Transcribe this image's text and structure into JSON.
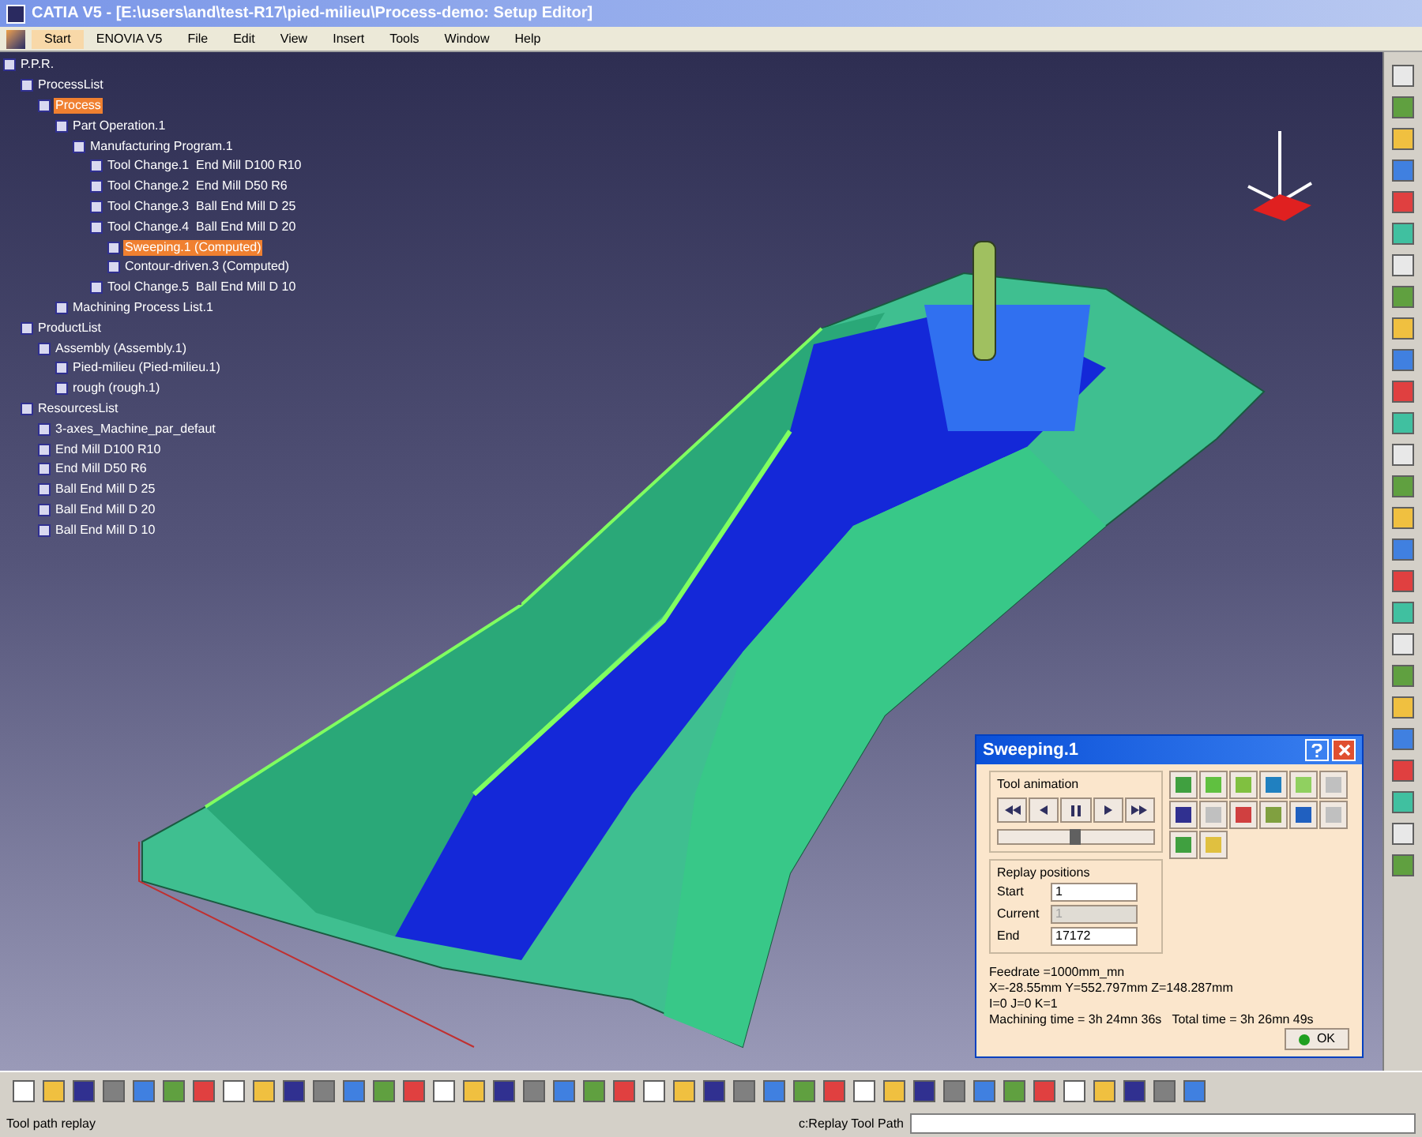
{
  "window": {
    "title": "CATIA V5 - [E:\\users\\and\\test-R17\\pied-milieu\\Process-demo: Setup Editor]"
  },
  "menu": [
    {
      "label": "Start",
      "selected": true
    },
    {
      "label": "ENOVIA V5",
      "selected": false
    },
    {
      "label": "File",
      "selected": false
    },
    {
      "label": "Edit",
      "selected": false
    },
    {
      "label": "View",
      "selected": false
    },
    {
      "label": "Insert",
      "selected": false
    },
    {
      "label": "Tools",
      "selected": false
    },
    {
      "label": "Window",
      "selected": false
    },
    {
      "label": "Help",
      "selected": false
    }
  ],
  "tree": [
    {
      "label": "P.P.R.",
      "selected": false,
      "children": [
        {
          "label": "ProcessList",
          "selected": false,
          "children": [
            {
              "label": "Process",
              "selected": true,
              "children": [
                {
                  "label": "Part Operation.1",
                  "selected": false,
                  "children": [
                    {
                      "label": "Manufacturing Program.1",
                      "selected": false,
                      "children": [
                        {
                          "label": "Tool Change.1  End Mill D100 R10",
                          "selected": false
                        },
                        {
                          "label": "Tool Change.2  End Mill D50 R6",
                          "selected": false
                        },
                        {
                          "label": "Tool Change.3  Ball End Mill D 25",
                          "selected": false
                        },
                        {
                          "label": "Tool Change.4  Ball End Mill D 20",
                          "selected": false,
                          "children": [
                            {
                              "label": "Sweeping.1 (Computed)",
                              "selected": true
                            },
                            {
                              "label": "Contour-driven.3 (Computed)",
                              "selected": false
                            }
                          ]
                        },
                        {
                          "label": "Tool Change.5  Ball End Mill D 10",
                          "selected": false
                        }
                      ]
                    }
                  ]
                },
                {
                  "label": "Machining Process List.1",
                  "selected": false
                }
              ]
            }
          ]
        },
        {
          "label": "ProductList",
          "selected": false,
          "children": [
            {
              "label": "Assembly (Assembly.1)",
              "selected": false,
              "children": [
                {
                  "label": "Pied-milieu (Pied-milieu.1)",
                  "selected": false
                },
                {
                  "label": "rough (rough.1)",
                  "selected": false
                }
              ]
            }
          ]
        },
        {
          "label": "ResourcesList",
          "selected": false,
          "children": [
            {
              "label": "3-axes_Machine_par_defaut",
              "selected": false
            },
            {
              "label": "End Mill D100 R10",
              "selected": false
            },
            {
              "label": "End Mill D50 R6",
              "selected": false
            },
            {
              "label": "Ball End Mill D 25",
              "selected": false
            },
            {
              "label": "Ball End Mill D 20",
              "selected": false
            },
            {
              "label": "Ball End Mill D 10",
              "selected": false
            }
          ]
        }
      ]
    }
  ],
  "dialog": {
    "title": "Sweeping.1",
    "tool_animation": {
      "label": "Tool animation",
      "slider": {
        "level": 0.5
      }
    },
    "replay_positions": {
      "label": "Replay positions",
      "fields": [
        {
          "label": "Start",
          "value": "1",
          "disabled": false
        },
        {
          "label": "Current",
          "value": "1",
          "disabled": true
        },
        {
          "label": "End",
          "value": "17172",
          "disabled": false
        }
      ]
    },
    "info": [
      "Feedrate =1000mm_mn",
      "X=-28.55mm Y=552.797mm Z=148.287mm",
      "I=0 J=0 K=1",
      "Machining time = 3h 24mn 36s   Total time = 3h 26mn 49s"
    ],
    "ok_button": "OK"
  },
  "status_bar": {
    "message": "Tool path replay",
    "command": "c:Replay Tool Path"
  }
}
